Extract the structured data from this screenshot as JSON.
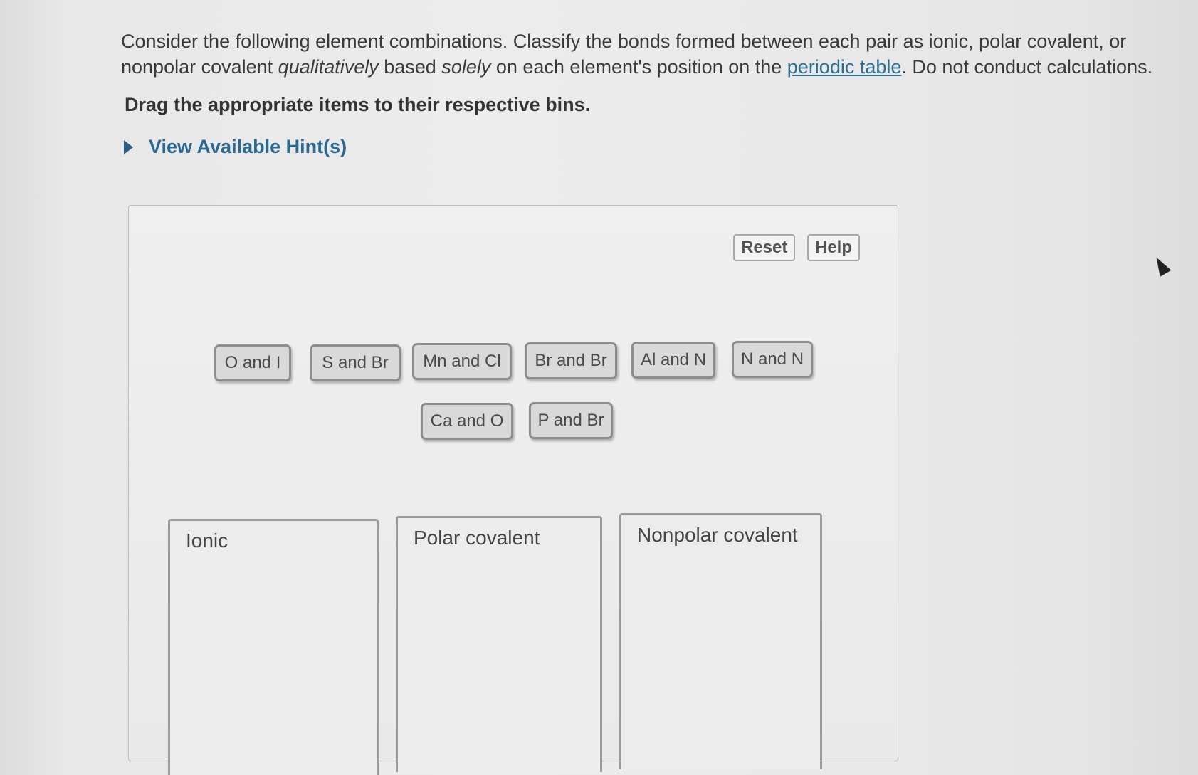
{
  "question": {
    "intro_part1": "Consider the following element combinations. Classify the bonds formed between each pair as ionic, polar covalent, or nonpolar covalent ",
    "intro_em1": "qualitatively",
    "intro_part2": " based ",
    "intro_em2": "solely",
    "intro_part3": " on each element's position on the ",
    "intro_link": "periodic table",
    "intro_part4": ". Do not conduct calculations.",
    "instruction": "Drag the appropriate items to their respective bins.",
    "hint_label": "View Available Hint(s)"
  },
  "controls": {
    "reset_label": "Reset",
    "help_label": "Help"
  },
  "items": [
    "O and I",
    "S and Br",
    "Mn and Cl",
    "Br and Br",
    "Al and N",
    "N and N",
    "Ca and O",
    "P and Br"
  ],
  "bins": [
    "Ionic",
    "Polar covalent",
    "Nonpolar covalent"
  ]
}
